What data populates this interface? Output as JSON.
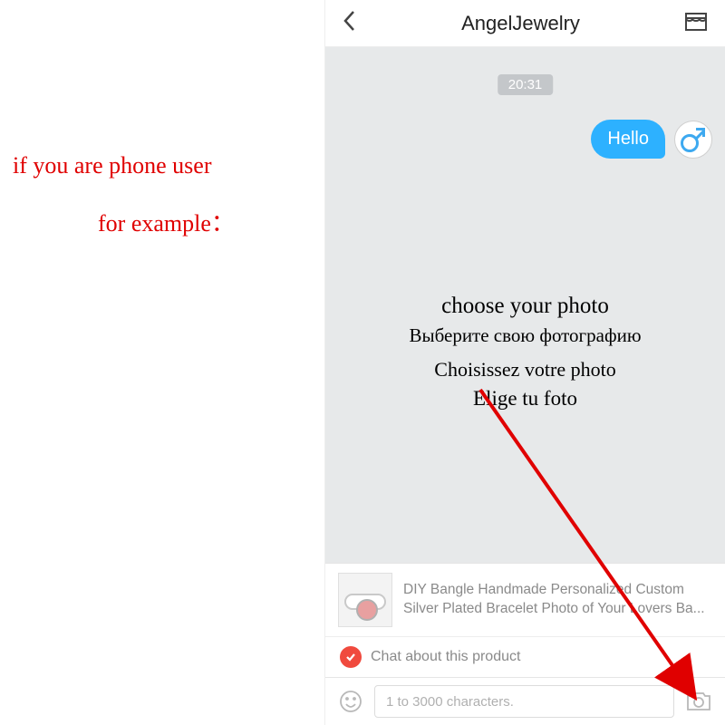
{
  "annotations": {
    "line1": "if you are phone user",
    "line2": "for example："
  },
  "header": {
    "title": "AngelJewelry"
  },
  "chat": {
    "timestamp": "20:31",
    "messages": [
      {
        "text": "Hello",
        "side": "out"
      }
    ]
  },
  "overlay": {
    "l1": "choose your photo",
    "l2": "Выберите свою фотографию",
    "l3": "Choisissez votre photo",
    "l4": "Elige tu foto"
  },
  "product": {
    "title_line1": "DIY Bangle Handmade Personalized Custom",
    "title_line2": "Silver Plated Bracelet Photo of Your Lovers Ba..."
  },
  "chat_about": {
    "label": "Chat about this product"
  },
  "input": {
    "placeholder": "1 to 3000 characters."
  },
  "icons": {
    "back": "back-chevron-icon",
    "shop": "shop-icon",
    "avatar": "male-symbol-icon",
    "check": "check-circle-icon",
    "smiley": "smiley-icon",
    "camera": "camera-icon"
  }
}
